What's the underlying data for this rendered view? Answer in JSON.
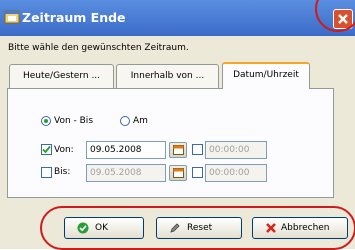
{
  "window": {
    "title": "Zeitraum Ende"
  },
  "prompt_text": "Bitte wähle den gewünschten Zeitraum.",
  "tabs": [
    {
      "label": "Heute/Gestern ..."
    },
    {
      "label": "Innerhalb von ..."
    },
    {
      "label": "Datum/Uhrzeit"
    }
  ],
  "mode": {
    "von_bis_label": "Von - Bis",
    "am_label": "Am",
    "selected": "Von - Bis"
  },
  "von": {
    "label": "Von:",
    "checked": true,
    "date": "09.05.2008",
    "time_checked": false,
    "time": "00:00:00"
  },
  "bis": {
    "label": "Bis:",
    "checked": false,
    "date": "09.05.2008",
    "time_checked": false,
    "time": "00:00:00"
  },
  "buttons": {
    "ok": "OK",
    "reset": "Reset",
    "cancel": "Abbrechen"
  },
  "icons": {
    "app": "app-window-icon",
    "calendar": "calendar-icon",
    "ok": "green-check-icon",
    "reset": "pen-icon",
    "cancel": "red-x-icon"
  },
  "colors": {
    "titlebar": "#3b6cc9",
    "close": "#d8502d",
    "annotation": "#d01b1b",
    "active_tab_accent": "#f5a623"
  }
}
